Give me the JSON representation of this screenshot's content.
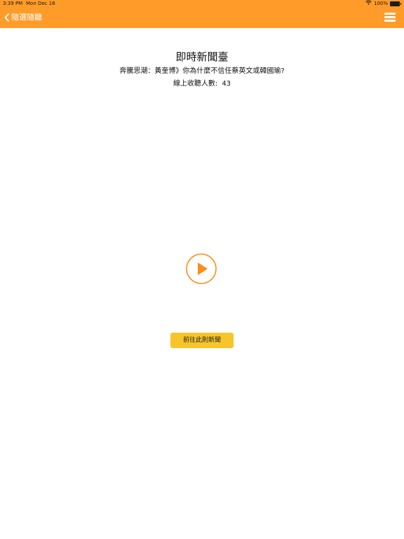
{
  "status_bar": {
    "time": "3:39 PM",
    "date": "Mon Dec 16",
    "battery": "100%"
  },
  "nav": {
    "back_label": "隨選隨聽"
  },
  "page": {
    "title": "即時新聞臺",
    "subtitle": "奔騰思潮：黃奎博》你為什麼不信任蔡英文或韓國瑜?",
    "listeners_label": "線上收聽人數:",
    "listeners_count": "43"
  },
  "actions": {
    "goto_label": "前往此則新聞"
  },
  "colors": {
    "nav_background": "#FF9B29",
    "play_accent": "#FF8C1A",
    "goto_button": "#F7C52A"
  },
  "icons": [
    "chevron-left-icon",
    "hamburger-menu-icon",
    "play-icon",
    "wifi-icon",
    "battery-icon"
  ]
}
